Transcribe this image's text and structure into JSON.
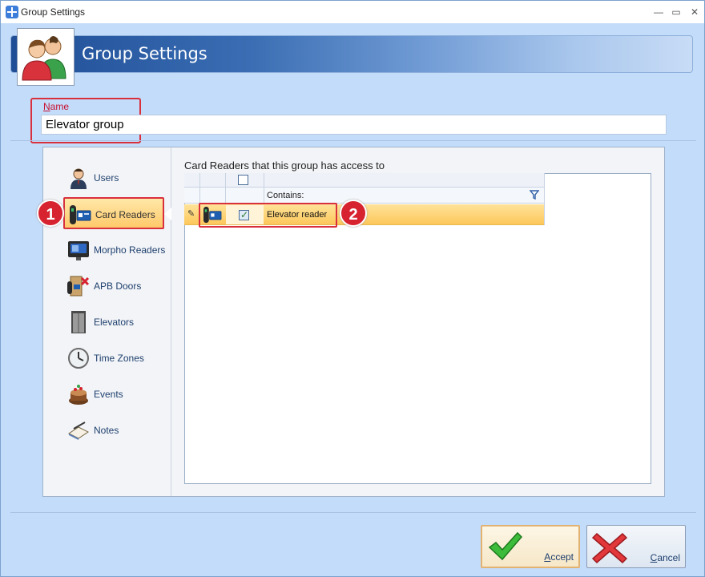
{
  "window": {
    "title": "Group Settings",
    "controls": [
      "—",
      "▭",
      "✕"
    ]
  },
  "header": {
    "title": "Group Settings"
  },
  "name_field": {
    "label_hotkey": "N",
    "label_rest": "ame",
    "value": "Elevator group"
  },
  "nav": {
    "items": [
      {
        "label": "Users",
        "icon": "users-icon"
      },
      {
        "label": "Card Readers",
        "icon": "card-reader-icon"
      },
      {
        "label": "Morpho Readers",
        "icon": "morpho-reader-icon"
      },
      {
        "label": "APB Doors",
        "icon": "apb-door-icon"
      },
      {
        "label": "Elevators",
        "icon": "elevator-icon"
      },
      {
        "label": "Time Zones",
        "icon": "clock-icon"
      },
      {
        "label": "Events",
        "icon": "events-icon"
      },
      {
        "label": "Notes",
        "icon": "notes-icon"
      }
    ],
    "active_index": 1
  },
  "grid": {
    "caption": "Card Readers that this group has access to",
    "filter_label": "Contains:",
    "rows": [
      {
        "checked": true,
        "name": "Elevator reader"
      }
    ]
  },
  "badges": [
    "1",
    "2"
  ],
  "buttons": {
    "accept": {
      "hotkey": "A",
      "rest": "ccept"
    },
    "cancel": {
      "hotkey": "C",
      "rest": "ancel"
    }
  },
  "colors": {
    "highlight_red": "#d9303e",
    "selection_orange": "#fcc75a",
    "header_blue": "#1f4e96"
  }
}
